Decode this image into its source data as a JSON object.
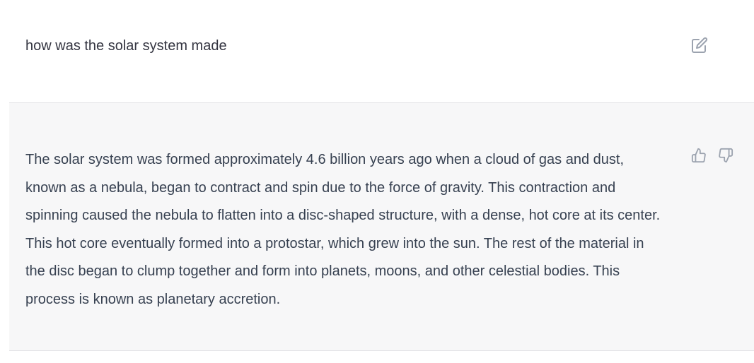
{
  "conversation": {
    "user_message": "how was the solar system made",
    "assistant_message": "The solar system was formed approximately 4.6 billion years ago when a cloud of gas and dust, known as a nebula, began to contract and spin due to the force of gravity. This contraction and spinning caused the nebula to flatten into a disc-shaped structure, with a dense, hot core at its center. This hot core eventually formed into a protostar, which grew into the sun. The rest of the material in the disc began to clump together and form into planets, moons, and other celestial bodies. This process is known as planetary accretion."
  },
  "icons": {
    "edit": "edit-icon",
    "thumbs_up": "thumbs-up-icon",
    "thumbs_down": "thumbs-down-icon"
  },
  "colors": {
    "user_bg": "#ffffff",
    "assistant_bg": "#f7f7f8",
    "icon": "#9ca3af",
    "text": "#374151"
  }
}
